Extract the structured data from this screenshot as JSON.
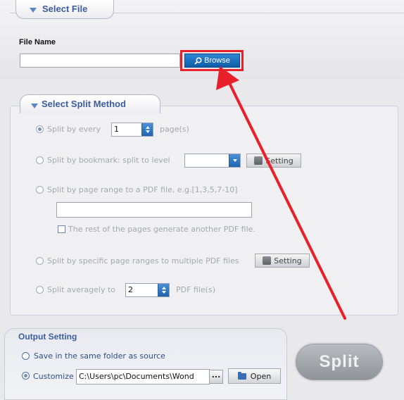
{
  "select_file": {
    "section_title": "Select File",
    "file_name_label": "File Name",
    "file_name_value": "",
    "browse_label": "Browse"
  },
  "split_method": {
    "section_title": "Select Split Method",
    "opt_every_label": "Split by every",
    "opt_every_value": "1",
    "opt_every_unit": "page(s)",
    "opt_bookmark_label": "Split by bookmark: split to level",
    "opt_bookmark_value": "",
    "opt_bookmark_setting": "Setting",
    "opt_range_label": "Split by page range to a PDF file, e.g.[1,3,5,7-10]",
    "opt_range_value": "",
    "opt_range_rest_label": "The rest of the pages generate another PDF file.",
    "opt_specific_label": "Split by specific page ranges to multiple PDF files",
    "opt_specific_setting": "Setting",
    "opt_average_label": "Split averagely to",
    "opt_average_value": "2",
    "opt_average_unit": "PDF file(s)"
  },
  "output": {
    "section_title": "Output Setting",
    "same_folder_label": "Save in the same folder as source",
    "customize_label": "Customize",
    "customize_path": "C:\\Users\\pc\\Documents\\Wond",
    "dots_label": "...",
    "open_label": "Open"
  },
  "split_button_label": "Split",
  "colors": {
    "accent_blue": "#1a6fc0",
    "highlight_red": "#e8202a",
    "section_title": "#3d5d9e"
  }
}
